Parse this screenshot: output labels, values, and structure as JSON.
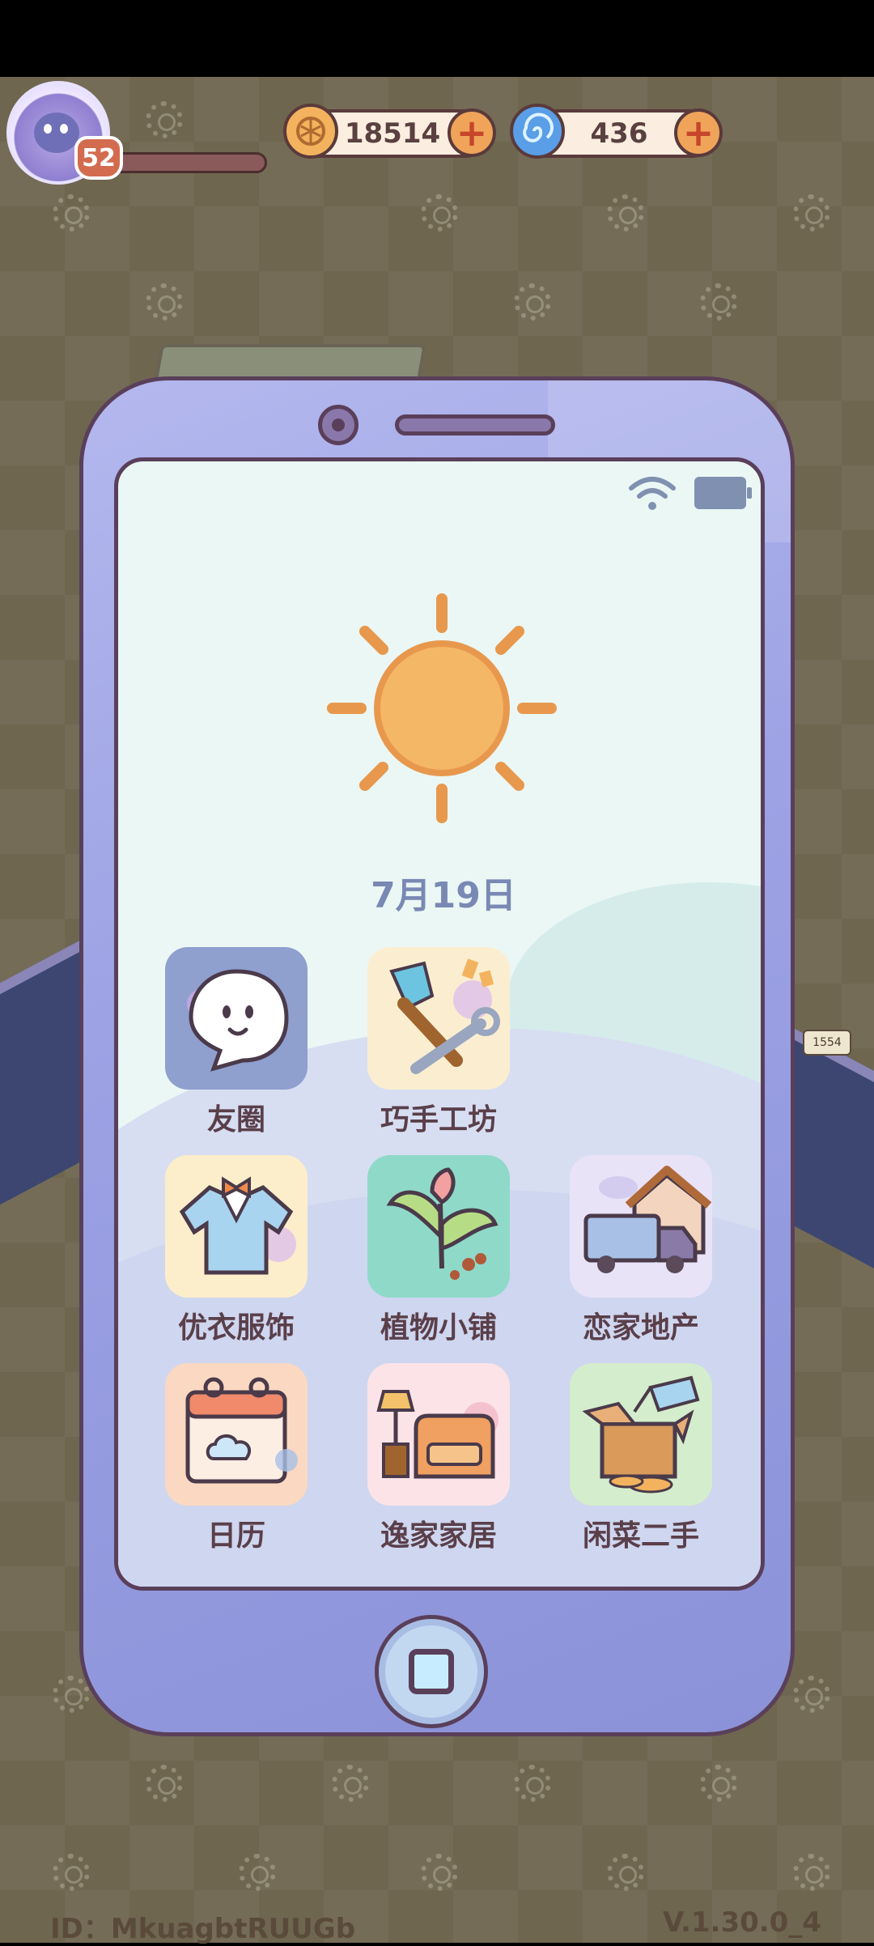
{
  "hud": {
    "level": "52",
    "coins": "18514",
    "gems": "436"
  },
  "phone": {
    "date": "7月19日",
    "apps": [
      {
        "label": "友圈",
        "icon": "chat-bubble-icon",
        "bg": "#8f9fce"
      },
      {
        "label": "巧手工坊",
        "icon": "brush-wrench-icon",
        "bg": "#fbeed0"
      },
      {
        "label": "优衣服饰",
        "icon": "shirt-icon",
        "bg": "#fdeecb"
      },
      {
        "label": "植物小铺",
        "icon": "plant-icon",
        "bg": "#8fd9c9"
      },
      {
        "label": "恋家地产",
        "icon": "moving-truck-icon",
        "bg": "#e9e3f8"
      },
      {
        "label": "日历",
        "icon": "calendar-icon",
        "bg": "#fbd8c2"
      },
      {
        "label": "逸家家居",
        "icon": "sofa-lamp-icon",
        "bg": "#fbe3e8"
      },
      {
        "label": "闲菜二手",
        "icon": "box-tag-icon",
        "bg": "#d4edcc"
      }
    ]
  },
  "world": {
    "sign_value": "1554"
  },
  "footer": {
    "id": "ID：MkuagbtRUUGb",
    "version": "V.1.30.0_4"
  }
}
